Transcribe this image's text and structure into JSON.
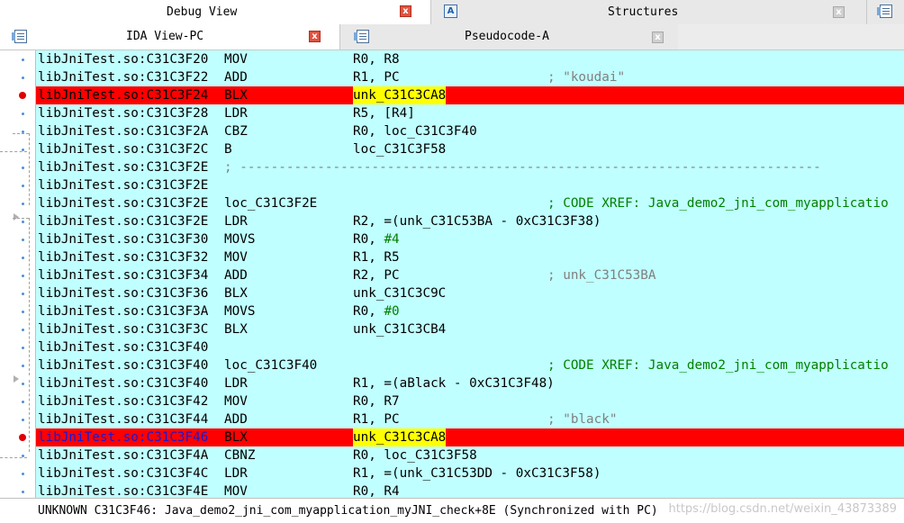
{
  "tabs_top": [
    {
      "label": "Debug View"
    },
    {
      "label": "Structures"
    }
  ],
  "tabs_second": [
    {
      "label": "IDA View-PC"
    },
    {
      "label": "Pseudocode-A"
    }
  ],
  "close_glyph": "x",
  "structures_icon_glyph": "A",
  "rows": [
    {
      "addr": "libJniTest.so:C31C3F20",
      "mn": "MOV",
      "op": "R0, R8",
      "cm": ""
    },
    {
      "addr": "libJniTest.so:C31C3F22",
      "mn": "ADD",
      "op": "R1, PC",
      "cm": "; \"koudai\""
    },
    {
      "addr": "libJniTest.so:C31C3F24",
      "mn": "BLX",
      "op": "unk_C31C3CA8",
      "cm": "",
      "hl": true
    },
    {
      "addr": "libJniTest.so:C31C3F28",
      "mn": "LDR",
      "op": "R5, [R4]",
      "cm": ""
    },
    {
      "addr": "libJniTest.so:C31C3F2A",
      "mn": "CBZ",
      "op": "R0, loc_C31C3F40",
      "cm": ""
    },
    {
      "addr": "libJniTest.so:C31C3F2C",
      "mn": "B",
      "op": "loc_C31C3F58",
      "cm": ""
    },
    {
      "addr": "libJniTest.so:C31C3F2E",
      "mn": "; ---------------------------------------------------------------------------",
      "op": "",
      "cm": "",
      "sep": true
    },
    {
      "addr": "libJniTest.so:C31C3F2E",
      "mn": "",
      "op": "",
      "cm": ""
    },
    {
      "addr": "libJniTest.so:C31C3F2E",
      "mn": "loc_C31C3F2E",
      "op": "",
      "cm": "; CODE XREF: Java_demo2_jni_com_myapplicatio",
      "xref": true
    },
    {
      "addr": "libJniTest.so:C31C3F2E",
      "mn": "LDR",
      "op": "R2, =(unk_C31C53BA - 0xC31C3F38)",
      "cm": ""
    },
    {
      "addr": "libJniTest.so:C31C3F30",
      "mn": "MOVS",
      "op": "R0, #4",
      "cm": ""
    },
    {
      "addr": "libJniTest.so:C31C3F32",
      "mn": "MOV",
      "op": "R1, R5",
      "cm": ""
    },
    {
      "addr": "libJniTest.so:C31C3F34",
      "mn": "ADD",
      "op": "R2, PC",
      "cm": "; unk_C31C53BA"
    },
    {
      "addr": "libJniTest.so:C31C3F36",
      "mn": "BLX",
      "op": "unk_C31C3C9C",
      "cm": ""
    },
    {
      "addr": "libJniTest.so:C31C3F3A",
      "mn": "MOVS",
      "op": "R0, #0",
      "cm": ""
    },
    {
      "addr": "libJniTest.so:C31C3F3C",
      "mn": "BLX",
      "op": "unk_C31C3CB4",
      "cm": ""
    },
    {
      "addr": "libJniTest.so:C31C3F40",
      "mn": "",
      "op": "",
      "cm": ""
    },
    {
      "addr": "libJniTest.so:C31C3F40",
      "mn": "loc_C31C3F40",
      "op": "",
      "cm": "; CODE XREF: Java_demo2_jni_com_myapplicatio",
      "xref": true
    },
    {
      "addr": "libJniTest.so:C31C3F40",
      "mn": "LDR",
      "op": "R1, =(aBlack - 0xC31C3F48)",
      "cm": ""
    },
    {
      "addr": "libJniTest.so:C31C3F42",
      "mn": "MOV",
      "op": "R0, R7",
      "cm": ""
    },
    {
      "addr": "libJniTest.so:C31C3F44",
      "mn": "ADD",
      "op": "R1, PC",
      "cm": "; \"black\""
    },
    {
      "addr": "libJniTest.so:C31C3F46",
      "mn": "BLX",
      "op": "unk_C31C3CA8",
      "cm": "",
      "hl": true,
      "sel": true
    },
    {
      "addr": "libJniTest.so:C31C3F4A",
      "mn": "CBNZ",
      "op": "R0, loc_C31C3F58",
      "cm": ""
    },
    {
      "addr": "libJniTest.so:C31C3F4C",
      "mn": "LDR",
      "op": "R1, =(unk_C31C53DD - 0xC31C3F58)",
      "cm": ""
    },
    {
      "addr": "libJniTest.so:C31C3F4E",
      "mn": "MOV",
      "op": "R0, R4",
      "cm": ""
    }
  ],
  "status": {
    "text": "UNKNOWN C31C3F46: Java_demo2_jni_com_myapplication_myJNI_check+8E (Synchronized with PC)",
    "watermark": "https://blog.csdn.net/weixin_43873389"
  }
}
